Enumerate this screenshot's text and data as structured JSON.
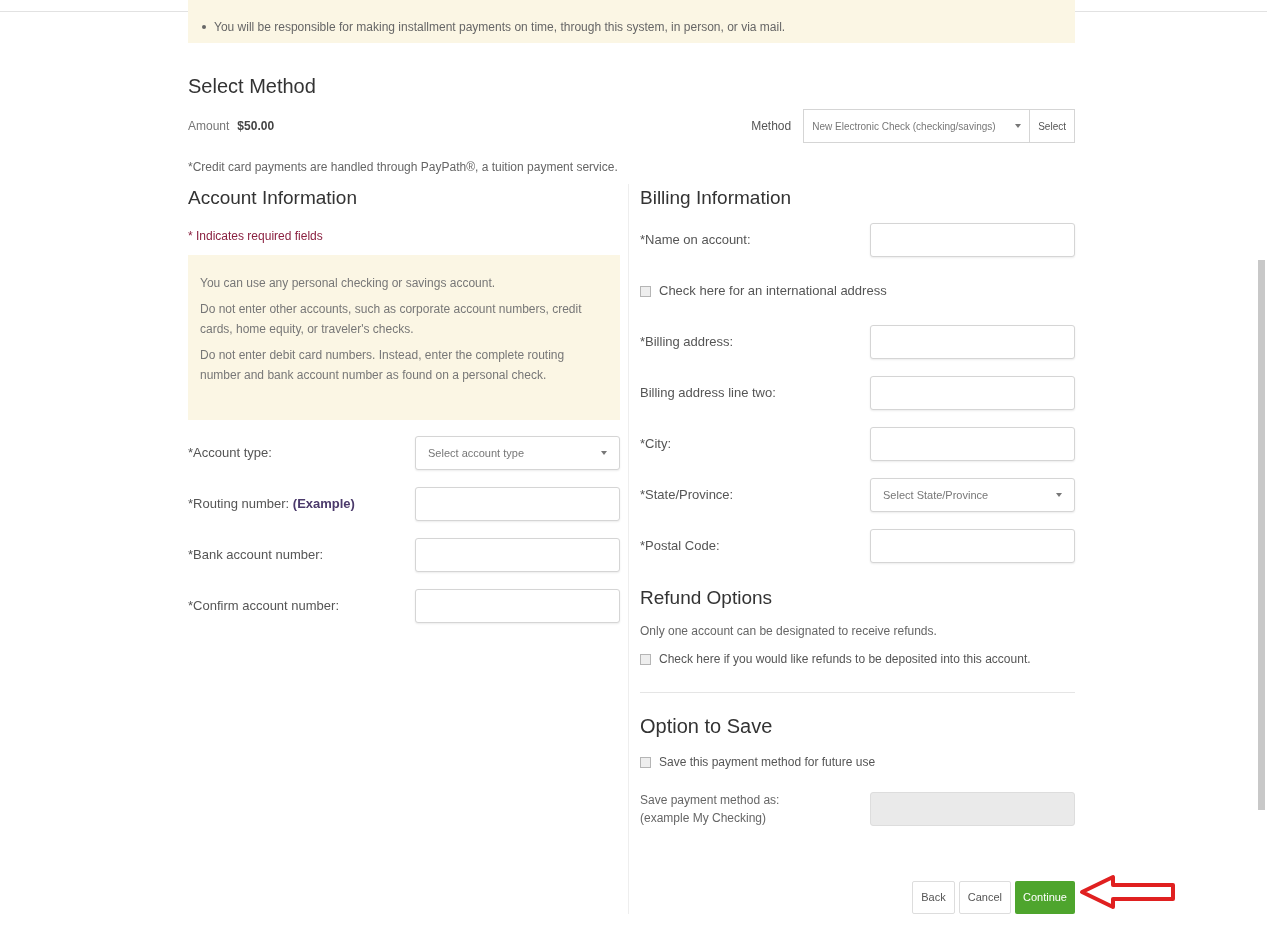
{
  "notice": {
    "text": "You will be responsible for making installment payments on time, through this system, in person, or via mail."
  },
  "select_method": {
    "title": "Select Method",
    "amount_label": "Amount",
    "amount": "$50.00",
    "method_label": "Method",
    "method_value": "New Electronic Check (checking/savings)",
    "select_button": "Select"
  },
  "credit_note": "*Credit card payments are handled through PayPath®, a tuition payment service.",
  "account": {
    "title": "Account Information",
    "required_note": "* Indicates required fields",
    "info": [
      "You can use any personal checking or savings account.",
      "Do not enter other accounts, such as corporate account numbers, credit cards, home equity, or traveler's checks.",
      "Do not enter debit card numbers. Instead, enter the complete routing number and bank account number as found on a personal check."
    ],
    "fields": [
      {
        "kind": "select",
        "label": "*Account type:",
        "value": "Select account type"
      },
      {
        "kind": "text",
        "label": "*Routing number:",
        "link": "(Example)"
      },
      {
        "kind": "text",
        "label": "*Bank account number:"
      },
      {
        "kind": "text",
        "label": "*Confirm account number:"
      }
    ]
  },
  "billing": {
    "title": "Billing Information",
    "fields": [
      {
        "kind": "text",
        "label": "*Name on account:"
      },
      {
        "kind": "checkbox",
        "label": "Check here for an international address",
        "checked": false
      },
      {
        "kind": "text",
        "label": "*Billing address:"
      },
      {
        "kind": "text",
        "label": "Billing address line two:"
      },
      {
        "kind": "text",
        "label": "*City:"
      },
      {
        "kind": "select",
        "label": "*State/Province:",
        "value": "Select State/Province"
      },
      {
        "kind": "text",
        "label": "*Postal Code:"
      }
    ]
  },
  "refund": {
    "title": "Refund Options",
    "note": "Only one account can be designated to receive refunds.",
    "checkbox": {
      "label": "Check here if you would like refunds to be deposited into this account.",
      "checked": false
    }
  },
  "save": {
    "title": "Option to Save",
    "checkbox": {
      "label": "Save this payment method for future use",
      "checked": false
    },
    "field_label": "Save payment method as:",
    "field_hint": "(example My Checking)",
    "field_disabled": true
  },
  "buttons": [
    {
      "kind": "default",
      "label": "Back"
    },
    {
      "kind": "default",
      "label": "Cancel"
    },
    {
      "kind": "primary",
      "label": "Continue"
    }
  ]
}
